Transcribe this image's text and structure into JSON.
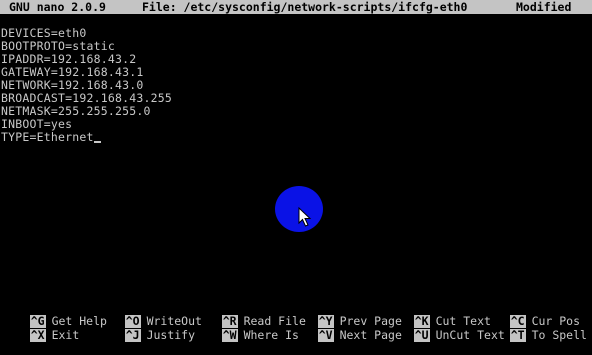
{
  "title_bar": {
    "app": "GNU nano 2.0.9",
    "file": "File: /etc/sysconfig/network-scripts/ifcfg-eth0",
    "status": "Modified"
  },
  "editor": {
    "lines": [
      "DEVICES=eth0",
      "BOOTPROTO=static",
      "IPADDR=192.168.43.2",
      "GATEWAY=192.168.43.1",
      "NETWORK=192.168.43.0",
      "BROADCAST=192.168.43.255",
      "NETMASK=255.255.255.0",
      "INBOOT=yes",
      "TYPE=Ethernet"
    ]
  },
  "shortcuts": [
    {
      "key": "^G",
      "label": "Get Help"
    },
    {
      "key": "^O",
      "label": "WriteOut"
    },
    {
      "key": "^R",
      "label": "Read File"
    },
    {
      "key": "^Y",
      "label": "Prev Page"
    },
    {
      "key": "^K",
      "label": "Cut Text"
    },
    {
      "key": "^C",
      "label": "Cur Pos"
    },
    {
      "key": "^X",
      "label": "Exit"
    },
    {
      "key": "^J",
      "label": "Justify"
    },
    {
      "key": "^W",
      "label": "Where Is"
    },
    {
      "key": "^V",
      "label": "Next Page"
    },
    {
      "key": "^U",
      "label": "UnCut Text"
    },
    {
      "key": "^T",
      "label": "To Spell"
    }
  ]
}
